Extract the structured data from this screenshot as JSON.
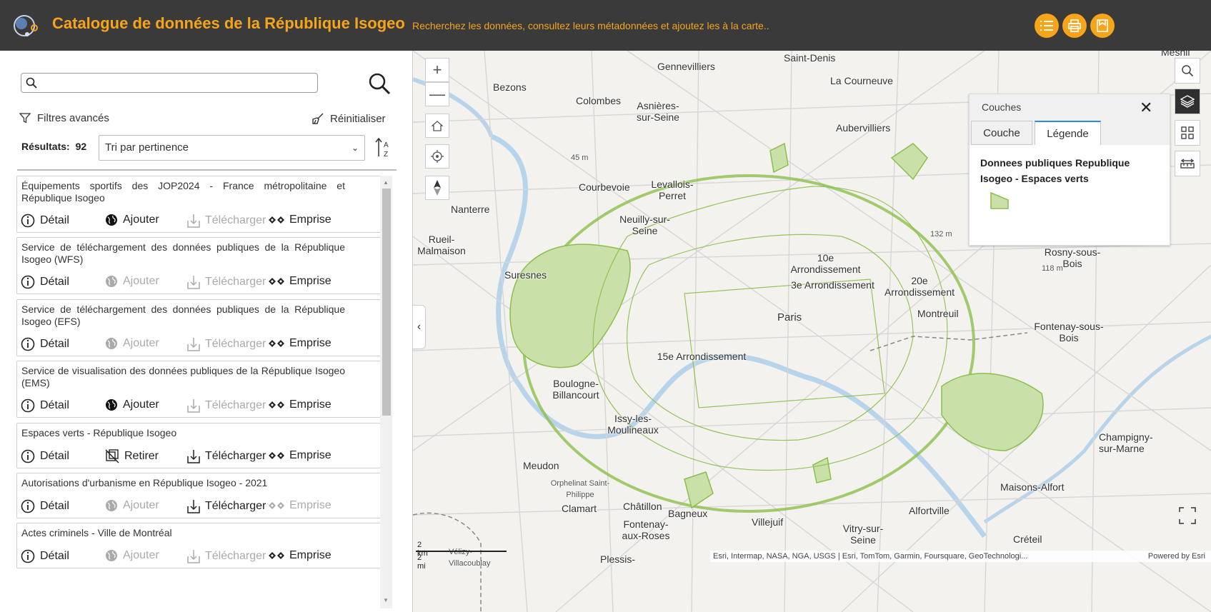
{
  "header": {
    "title": "Catalogue de données de la République Isogeo",
    "subtitle": "Recherchez les données, consultez leurs métadonnées et ajoutez les à la carte..",
    "accent": "#f6a51a",
    "buttons": [
      "list-icon",
      "print-icon",
      "bookmark-icon"
    ]
  },
  "search": {
    "value": "",
    "placeholder": ""
  },
  "filters": {
    "advanced_label": "Filtres avancés",
    "reset_label": "Réinitialiser"
  },
  "results": {
    "label": "Résultats:",
    "count": "92",
    "sort_selected": "Tri par pertinence"
  },
  "cards": [
    {
      "title": "Équipements sportifs des JOP2024 - France métropolitaine et République Isogeo",
      "detail": "Détail",
      "add": "Ajouter",
      "download": "Télécharger",
      "extent": "Emprise",
      "add_enabled": true,
      "download_enabled": false,
      "extent_enabled": true
    },
    {
      "title": "Service de téléchargement des données publiques de la République Isogeo (WFS)",
      "detail": "Détail",
      "add": "Ajouter",
      "download": "Télécharger",
      "extent": "Emprise",
      "add_enabled": false,
      "download_enabled": false,
      "extent_enabled": true
    },
    {
      "title": "Service de téléchargement des données publiques de la République Isogeo (EFS)",
      "detail": "Détail",
      "add": "Ajouter",
      "download": "Télécharger",
      "extent": "Emprise",
      "add_enabled": false,
      "download_enabled": false,
      "extent_enabled": true
    },
    {
      "title": "Service de visualisation des données publiques de la République Isogeo (EMS)",
      "detail": "Détail",
      "add": "Ajouter",
      "download": "Télécharger",
      "extent": "Emprise",
      "add_enabled": true,
      "download_enabled": false,
      "extent_enabled": true
    },
    {
      "title": "Espaces verts - République Isogeo",
      "detail": "Détail",
      "add": "Retirer",
      "download": "Télécharger",
      "extent": "Emprise",
      "add_enabled": true,
      "download_enabled": true,
      "extent_enabled": true
    },
    {
      "title": "Autorisations d'urbanisme en République Isogeo - 2021",
      "detail": "Détail",
      "add": "Ajouter",
      "download": "Télécharger",
      "extent": "Emprise",
      "add_enabled": false,
      "download_enabled": true,
      "extent_enabled": false
    },
    {
      "title": "Actes criminels - Ville de Montréal",
      "detail": "Détail",
      "add": "Ajouter",
      "download": "Télécharger",
      "extent": "Emprise",
      "add_enabled": false,
      "download_enabled": false,
      "extent_enabled": true
    }
  ],
  "map": {
    "labels": [
      "Saint-Denis",
      "Mesnil",
      "Gennevilliers",
      "La Courneuve",
      "Bezons",
      "Colombes",
      "Asnières-sur-Seine",
      "Aubervilliers",
      "Courbevoie",
      "Levallois-Perret",
      "Nanterre",
      "Neuilly-sur-Seine",
      "Rueil-Malmaison",
      "Suresnes",
      "10e Arrondissement",
      "3e Arrondissement",
      "20e Arrondissement",
      "Paris",
      "Montreuil",
      "Rosny-sous-Bois",
      "Fontenay-sous-Bois",
      "15e Arrondissement",
      "Boulogne-Billancourt",
      "Issy-les-Moulineaux",
      "Meudon",
      "Orphelinat Saint-Philippe",
      "Clamart",
      "Châtillon",
      "Bagneux",
      "Fontenay-aux-Roses",
      "Villejuif",
      "Vitry-sur-Seine",
      "Alfortville",
      "Maisons-Alfort",
      "Créteil",
      "Champigny-sur-Marne",
      "Plessis-",
      "Vélizy-Villacoublay",
      "45 m",
      "132 m",
      "118 m"
    ],
    "scale_km": "2 km",
    "scale_mi": "2 mi",
    "attribution": "Esri, Intermap, NASA, NGA, USGS | Esri, TomTom, Garmin, Foursquare, GeoTechnologi...",
    "powered_by": "Powered by Esri",
    "green_color": "#7cb342"
  },
  "layers_panel": {
    "title": "Couches",
    "tabs": [
      "Couche",
      "Légende"
    ],
    "active_tab": "Légende",
    "layer_name": "Donnees publiques Republique Isogeo - Espaces verts"
  }
}
